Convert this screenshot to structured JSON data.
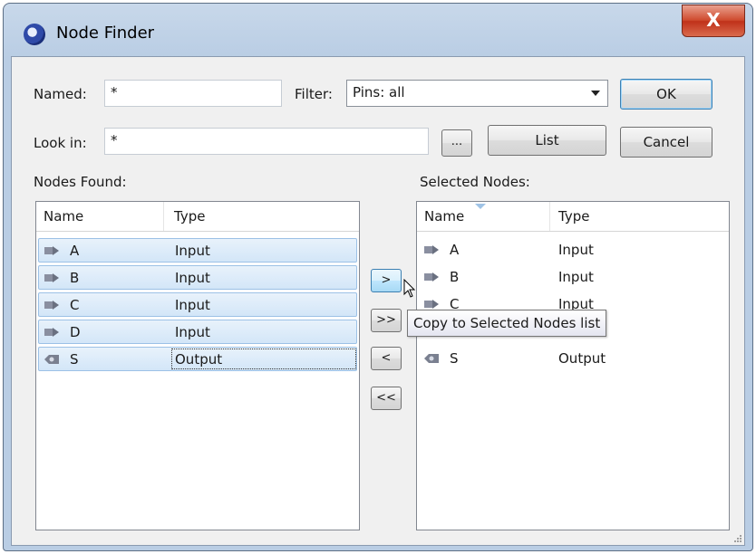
{
  "window": {
    "title": "Node Finder",
    "close_label": "X"
  },
  "named": {
    "label": "Named:",
    "value": "*"
  },
  "filter": {
    "label": "Filter:",
    "value": "Pins: all"
  },
  "look_in": {
    "label": "Look in:",
    "value": "*"
  },
  "buttons": {
    "ok": "OK",
    "cancel": "Cancel",
    "browse": "...",
    "list": "List",
    "copy_one": ">",
    "copy_all": ">>",
    "remove_one": "<",
    "remove_all": "<<"
  },
  "nodes_found": {
    "label": "Nodes Found:",
    "columns": [
      "Name",
      "Type"
    ],
    "rows": [
      {
        "name": "A",
        "type": "Input"
      },
      {
        "name": "B",
        "type": "Input"
      },
      {
        "name": "C",
        "type": "Input"
      },
      {
        "name": "D",
        "type": "Input"
      },
      {
        "name": "S",
        "type": "Output"
      }
    ]
  },
  "selected_nodes": {
    "label": "Selected Nodes:",
    "columns": [
      "Name",
      "Type"
    ],
    "rows": [
      {
        "name": "A",
        "type": "Input"
      },
      {
        "name": "B",
        "type": "Input"
      },
      {
        "name": "C",
        "type": "Input"
      },
      {
        "name": "S",
        "type": "Output"
      }
    ]
  },
  "tooltip": "Copy to Selected Nodes list",
  "icons": {
    "input_pin": "input-pin-icon",
    "output_pin": "output-pin-icon"
  }
}
